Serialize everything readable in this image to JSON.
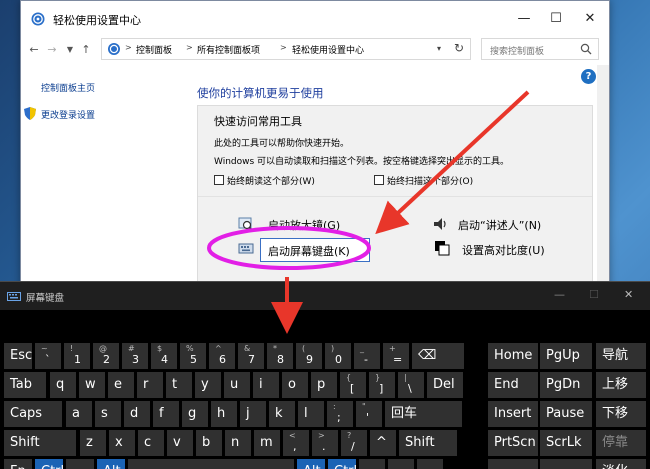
{
  "control_panel": {
    "title": "轻松使用设置中心",
    "window_buttons": {
      "minimize": "—",
      "maximize": "☐",
      "close": "✕"
    },
    "breadcrumbs": [
      "控制面板",
      "所有控制面板项",
      "轻松使用设置中心"
    ],
    "search_placeholder": "搜索控制面板",
    "help": "?",
    "sidebar": {
      "home_link": "控制面板主页",
      "logon_link": "更改登录设置"
    },
    "heading": "使你的计算机更易于使用",
    "quick_access": {
      "title": "快速访问常用工具",
      "line1": "此处的工具可以帮助你快速开始。",
      "line2": "Windows 可以自动读取和扫描这个列表。按空格键选择突出显示的工具。",
      "check1": "始终朗读这个部分(W)",
      "check2": "始终扫描这个部分(O)",
      "tools": {
        "magnifier": "启动放大镜(G)",
        "onscreen_keyboard": "启动屏幕键盘(K)",
        "narrator": "启动“讲述人”(N)",
        "high_contrast": "设置高对比度(U)"
      }
    }
  },
  "osk": {
    "title": "屏幕键盘",
    "buttons": {
      "minimize": "—",
      "maximize": "☐",
      "close": "✕"
    },
    "row1": {
      "esc": "Esc",
      "symbols": [
        {
          "shift": "~",
          "main": "`"
        },
        {
          "shift": "!",
          "main": "1"
        },
        {
          "shift": "@",
          "main": "2"
        },
        {
          "shift": "#",
          "main": "3"
        },
        {
          "shift": "$",
          "main": "4"
        },
        {
          "shift": "%",
          "main": "5"
        },
        {
          "shift": "^",
          "main": "6"
        },
        {
          "shift": "&",
          "main": "7"
        },
        {
          "shift": "*",
          "main": "8"
        },
        {
          "shift": "(",
          "main": "9"
        },
        {
          "shift": ")",
          "main": "0"
        },
        {
          "shift": "_",
          "main": "-"
        },
        {
          "shift": "+",
          "main": "="
        }
      ],
      "backspace": "⌫"
    },
    "row2": {
      "tab": "Tab",
      "letters": [
        "q",
        "w",
        "e",
        "r",
        "t",
        "y",
        "u",
        "i",
        "o",
        "p"
      ],
      "symbols": [
        {
          "shift": "{",
          "main": "["
        },
        {
          "shift": "}",
          "main": "]"
        },
        {
          "shift": "|",
          "main": "\\"
        }
      ],
      "del": "Del"
    },
    "row3": {
      "caps": "Caps",
      "letters": [
        "a",
        "s",
        "d",
        "f",
        "g",
        "h",
        "j",
        "k",
        "l"
      ],
      "symbols": [
        {
          "shift": ":",
          "main": ";"
        },
        {
          "shift": "\"",
          "main": "'"
        }
      ],
      "enter": "回车"
    },
    "row4": {
      "shift_left": "Shift",
      "letters": [
        "z",
        "x",
        "c",
        "v",
        "b",
        "n",
        "m"
      ],
      "symbols": [
        {
          "shift": "<",
          "main": ","
        },
        {
          "shift": ">",
          "main": "."
        },
        {
          "shift": "?",
          "main": "/"
        }
      ],
      "up": "^",
      "shift_right": "Shift"
    },
    "row5": {
      "fn": "Fn",
      "ctrl": "Ctrl",
      "alt": "Alt",
      "alt_r": "Alt",
      "ctrl_r": "Ctrl"
    },
    "nav_keys": [
      [
        "Home",
        "PgUp",
        "导航"
      ],
      [
        "End",
        "PgDn",
        "上移"
      ],
      [
        "Insert",
        "Pause",
        "下移"
      ],
      [
        "PrtScn",
        "ScrLk",
        "停靠"
      ],
      [
        "",
        "",
        "淡化"
      ]
    ]
  },
  "colors": {
    "annotation_red": "#e8362a",
    "annotation_magenta": "#e21fe6",
    "osk_key": "#303030",
    "osk_active_key": "#1b63b5",
    "link_blue": "#1e3e9e"
  }
}
